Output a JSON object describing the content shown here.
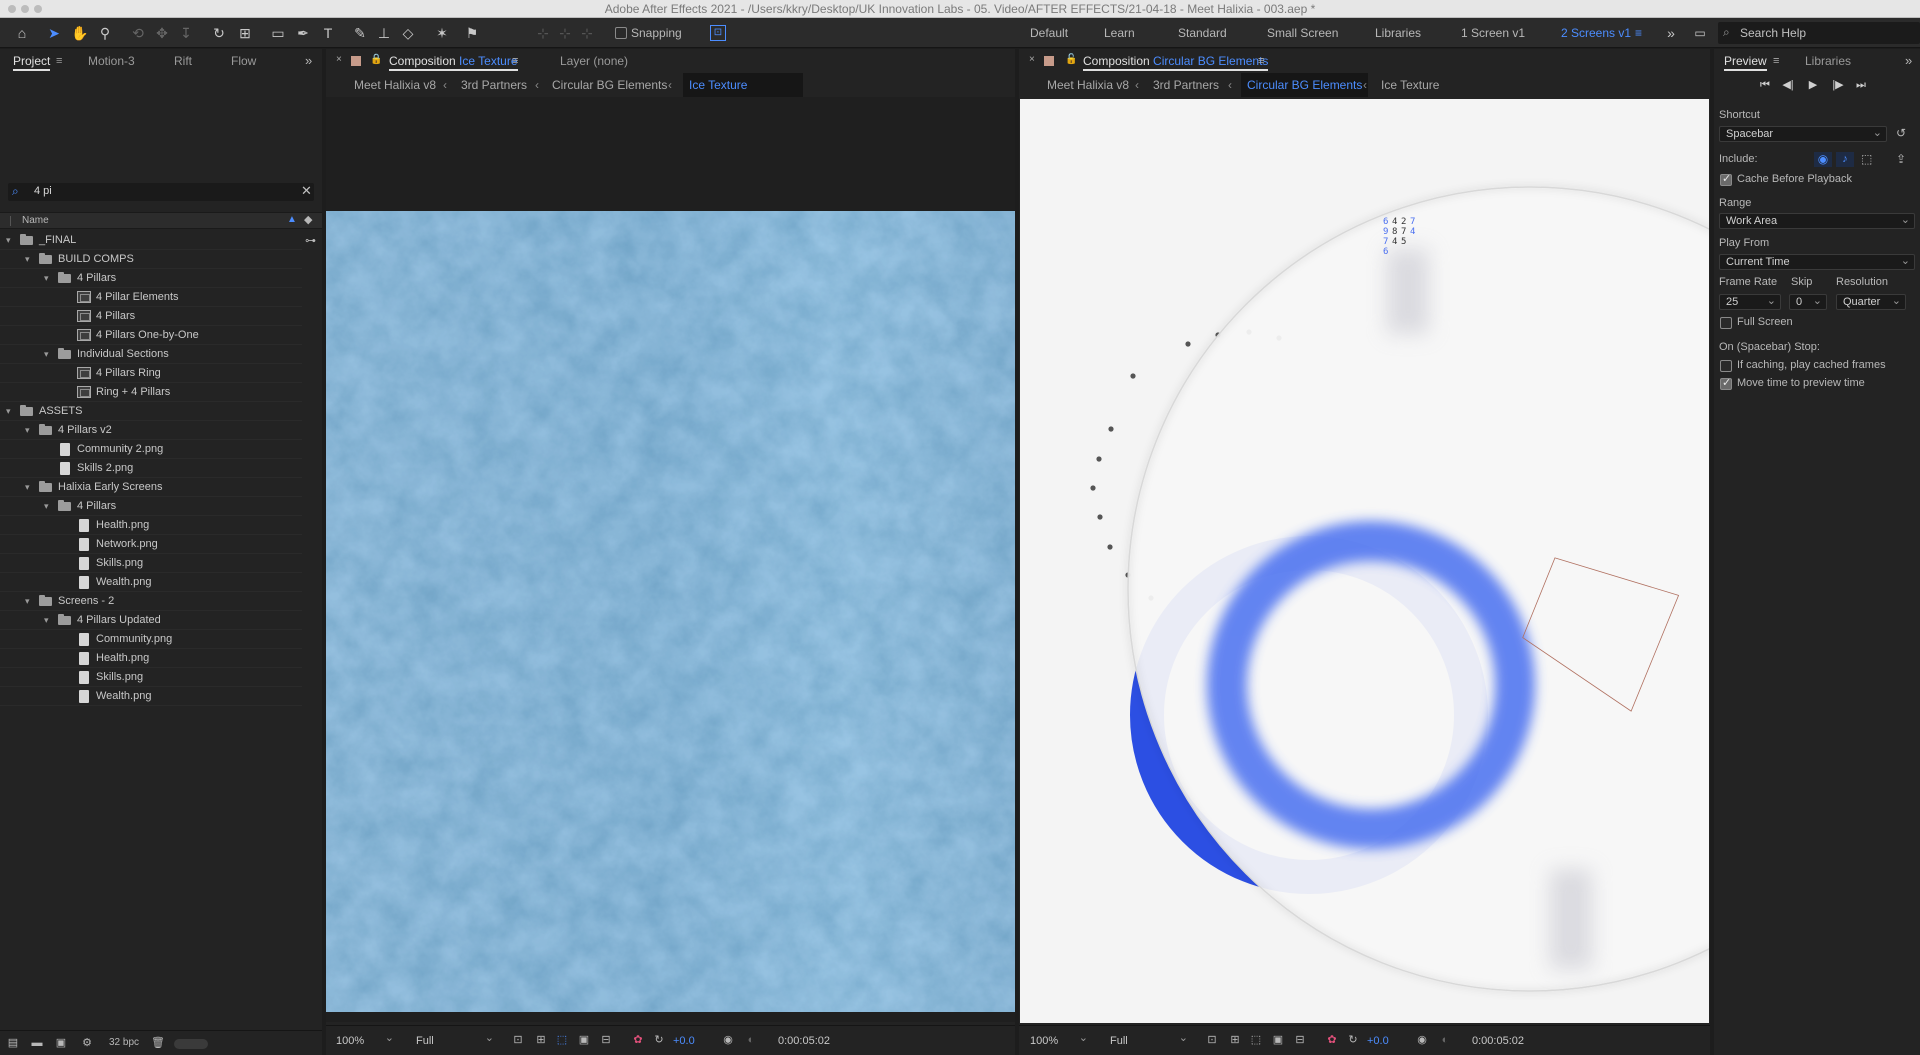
{
  "window": {
    "title": "Adobe After Effects 2021 - /Users/kkry/Desktop/UK Innovation Labs - 05. Video/AFTER EFFECTS/21-04-18 - Meet Halixia - 003.aep *"
  },
  "toolbar": {
    "snapping_label": "Snapping",
    "workspaces": [
      "Default",
      "Learn",
      "Standard",
      "Small Screen",
      "Libraries",
      "1 Screen v1",
      "2 Screens v1"
    ],
    "active_workspace": "2 Screens v1",
    "search_placeholder": "Search Help"
  },
  "project_panel": {
    "tabs": [
      "Project",
      "Motion-3",
      "Rift",
      "Flow"
    ],
    "search_value": "4 pi",
    "column_name": "Name",
    "tree": [
      {
        "label": "_FINAL",
        "kind": "folder",
        "depth": 0
      },
      {
        "label": "BUILD COMPS",
        "kind": "folder",
        "depth": 1
      },
      {
        "label": "4 Pillars",
        "kind": "folder",
        "depth": 2
      },
      {
        "label": "4 Pillar Elements",
        "kind": "comp",
        "depth": 3
      },
      {
        "label": "4 Pillars",
        "kind": "comp",
        "depth": 3
      },
      {
        "label": "4 Pillars One-by-One",
        "kind": "comp",
        "depth": 3
      },
      {
        "label": "Individual Sections",
        "kind": "folder",
        "depth": 2
      },
      {
        "label": "4 Pillars Ring",
        "kind": "comp",
        "depth": 3
      },
      {
        "label": "Ring + 4 Pillars",
        "kind": "comp",
        "depth": 3
      },
      {
        "label": "ASSETS",
        "kind": "folder",
        "depth": 0
      },
      {
        "label": "4 Pillars v2",
        "kind": "folder",
        "depth": 1
      },
      {
        "label": "Community 2.png",
        "kind": "file",
        "depth": 2
      },
      {
        "label": "Skills 2.png",
        "kind": "file",
        "depth": 2
      },
      {
        "label": "Halixia Early Screens",
        "kind": "folder",
        "depth": 1
      },
      {
        "label": "4 Pillars",
        "kind": "folder",
        "depth": 2
      },
      {
        "label": "Health.png",
        "kind": "file",
        "depth": 3
      },
      {
        "label": "Network.png",
        "kind": "file",
        "depth": 3
      },
      {
        "label": "Skills.png",
        "kind": "file",
        "depth": 3
      },
      {
        "label": "Wealth.png",
        "kind": "file",
        "depth": 3
      },
      {
        "label": "Screens - 2",
        "kind": "folder",
        "depth": 1
      },
      {
        "label": "4 Pillars Updated",
        "kind": "folder",
        "depth": 2
      },
      {
        "label": "Community.png",
        "kind": "file",
        "depth": 3
      },
      {
        "label": "Health.png",
        "kind": "file",
        "depth": 3
      },
      {
        "label": "Skills.png",
        "kind": "file",
        "depth": 3
      },
      {
        "label": "Wealth.png",
        "kind": "file",
        "depth": 3
      }
    ],
    "bpc_label": "32 bpc"
  },
  "comp_left": {
    "tab_prefix": "Composition",
    "tab_name": "Ice Texture",
    "layer_tab": "Layer (none)",
    "crumbs": [
      "Meet Halixia v8",
      "3rd Partners",
      "Circular BG Elements",
      "Ice Texture"
    ],
    "active_crumb": "Ice Texture",
    "zoom": "100%",
    "resolution": "Full",
    "exposure": "+0.0",
    "timecode": "0:00:05:02"
  },
  "comp_right": {
    "tab_prefix": "Composition",
    "tab_name": "Circular BG Elements",
    "crumbs": [
      "Meet Halixia v8",
      "3rd Partners",
      "Circular BG Elements",
      "Ice Texture"
    ],
    "active_crumb": "Circular BG Elements",
    "zoom": "100%",
    "resolution": "Full",
    "exposure": "+0.0",
    "timecode": "0:00:05:02",
    "digits": [
      [
        "6",
        "4",
        "2",
        "7"
      ],
      [
        "9",
        "8",
        "7",
        "4"
      ],
      [
        "7",
        "4",
        "5",
        ""
      ],
      [
        "6",
        "",
        "",
        ""
      ]
    ]
  },
  "preview_panel": {
    "tabs": [
      "Preview",
      "Libraries"
    ],
    "shortcut_label": "Shortcut",
    "shortcut_value": "Spacebar",
    "include_label": "Include:",
    "cache_label": "Cache Before Playback",
    "range_label": "Range",
    "range_value": "Work Area",
    "play_from_label": "Play From",
    "play_from_value": "Current Time",
    "frame_rate_label": "Frame Rate",
    "frame_rate_value": "25",
    "skip_label": "Skip",
    "skip_value": "0",
    "resolution_label": "Resolution",
    "resolution_value": "Quarter",
    "full_screen_label": "Full Screen",
    "stop_label": "On (Spacebar) Stop:",
    "cached_frames_label": "If caching, play cached frames",
    "move_time_label": "Move time to preview time",
    "cache_checked": true,
    "full_screen_checked": false,
    "cached_frames_checked": false,
    "move_time_checked": true
  },
  "colors": {
    "accent": "#4c8dff",
    "ring_blue": "#2c4fe3",
    "panel": "#232323"
  }
}
